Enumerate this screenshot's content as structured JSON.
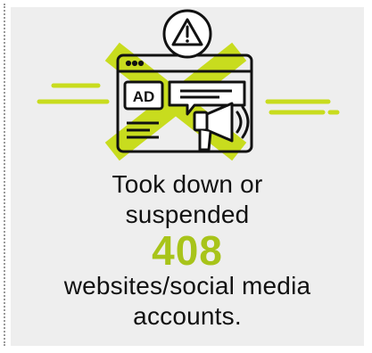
{
  "illustration": {
    "badge_text": "AD",
    "icons": [
      "warning-icon",
      "browser-window-icon",
      "ad-badge-icon",
      "megaphone-icon",
      "x-mark-icon"
    ],
    "colors": {
      "accent": "#c8dc1e",
      "number": "#a8c41a",
      "stroke": "#111111",
      "background": "#eeeeee"
    }
  },
  "stat": {
    "line1": "Took down or",
    "line2": "suspended",
    "number": "408",
    "line3": "websites/social media",
    "line4": "accounts."
  }
}
